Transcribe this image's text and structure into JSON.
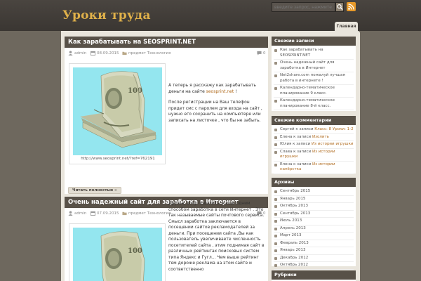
{
  "site": {
    "title": "Уроки труда"
  },
  "search": {
    "placeholder": "введите запрос, нажмите enter"
  },
  "nav": {
    "home": "Главная"
  },
  "posts": [
    {
      "title": "Как зарабатывать на SEOSPRINT.NET",
      "author": "admin",
      "date": "08.09.2015",
      "category": "предмет Технология",
      "comments": "0",
      "caption": "http://www.seosprint.net/?ref=762191",
      "text1": "А теперь я расскажу как зарабатывать деньги на сайте ",
      "link": "seosprint.net",
      "text1_end": " !",
      "text2": "После регистрации на Ваш телефон придет смс с паролем для входа на сайт , нужно его сохранить на компьютере или записать на листочке , что бы не забыть.",
      "readmore": "Читать полностью »"
    },
    {
      "title": "Очень надежный сайт для заработка в Интернет",
      "author": "admin",
      "date": "07.09.2015",
      "category": "предмет Технология",
      "comments": "0",
      "text1": "Друзья, хочу поделиться еще одним способом заработка в сети Интернет . Это так называемые сайты почтового  сервиса. Смысл заработка заключается в посещении сайтов рекламодателей за деньги. При посещении сайта ,Вы как пользователь увеличиваете численность посетителей сайта , этим поднимая сайт в различных рейтингах поисковых систем типа Яндекс и Гугл... Чем выше рейтинг тем дороже реклама на этом сайте и соответственно"
    }
  ],
  "sidebar": {
    "recent_title": "Свежие записи",
    "recent": [
      "Как зарабатывать на SEOSPRINT.NET",
      "Очень надежный сайт для заработка в Интернет",
      "Net2share.com пожалуй лучшая работа в интернете !",
      "Календарно-тематическое планирование 9 класс.",
      "Календарно-тематическое планирование 8-й класс."
    ],
    "comments_title": "Свежие комментарии",
    "comments": [
      {
        "who": "Сергей",
        "on": " к записи ",
        "post": "Класс: 8 Уроки: 1-2"
      },
      {
        "who": "Елена",
        "on": " к записи ",
        "post": "Изолить"
      },
      {
        "who": "Юлия",
        "on": " к записи ",
        "post": "Из истории игрушки"
      },
      {
        "who": "Слава",
        "on": " к записи ",
        "post": "Из истории игрушки"
      },
      {
        "who": "Елена",
        "on": " к записи ",
        "post": "Из истории напёрстка"
      }
    ],
    "archives_title": "Архивы",
    "archives": [
      "Сентябрь 2015",
      "Январь 2015",
      "Октябрь 2013",
      "Сентябрь 2013",
      "Июль 2013",
      "Апрель 2013",
      "Март 2013",
      "Февраль 2013",
      "Январь 2013",
      "Декабрь 2012",
      "Октябрь 2012"
    ],
    "rubrics_title": "Рубрики"
  }
}
